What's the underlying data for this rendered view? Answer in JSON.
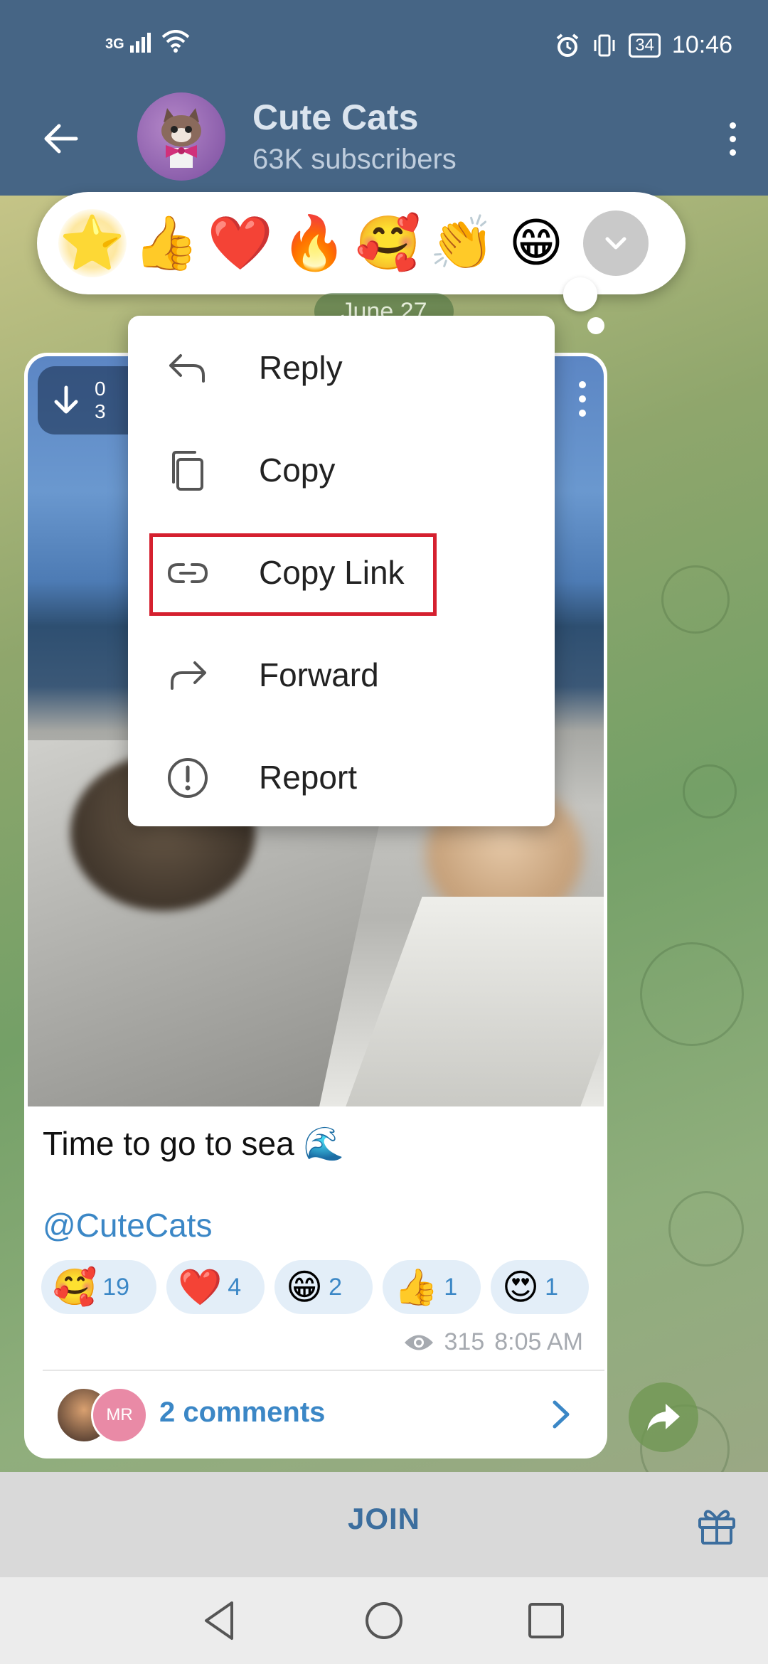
{
  "status_bar": {
    "network": "3G",
    "battery": "34",
    "time": "10:46"
  },
  "channel": {
    "title": "Cute Cats",
    "subtitle": "63K subscribers"
  },
  "reactions_picker": [
    "⭐",
    "👍",
    "❤️",
    "🔥",
    "🥰",
    "👏",
    "😁"
  ],
  "date_pill": "June 27",
  "media": {
    "badge_line1": "0",
    "badge_line2": "3"
  },
  "context_menu": {
    "reply": "Reply",
    "copy": "Copy",
    "copy_link": "Copy Link",
    "forward": "Forward",
    "report": "Report"
  },
  "message": {
    "caption": "Time to go to sea 🌊",
    "mention": "@CuteCats",
    "reactions": [
      {
        "emoji": "🥰",
        "count": "19"
      },
      {
        "emoji": "❤️",
        "count": "4"
      },
      {
        "emoji": "😁",
        "count": "2"
      },
      {
        "emoji": "👍",
        "count": "1"
      },
      {
        "emoji": "😍",
        "count": "1"
      }
    ],
    "views": "315",
    "time": "8:05 AM",
    "comment_avatar_initials": "MR",
    "comments_label": "2 comments"
  },
  "join_bar": {
    "join_label": "JOIN"
  },
  "colors": {
    "header": "#466585",
    "accent_blue": "#3b87c6",
    "highlight_red": "#d5202f"
  }
}
